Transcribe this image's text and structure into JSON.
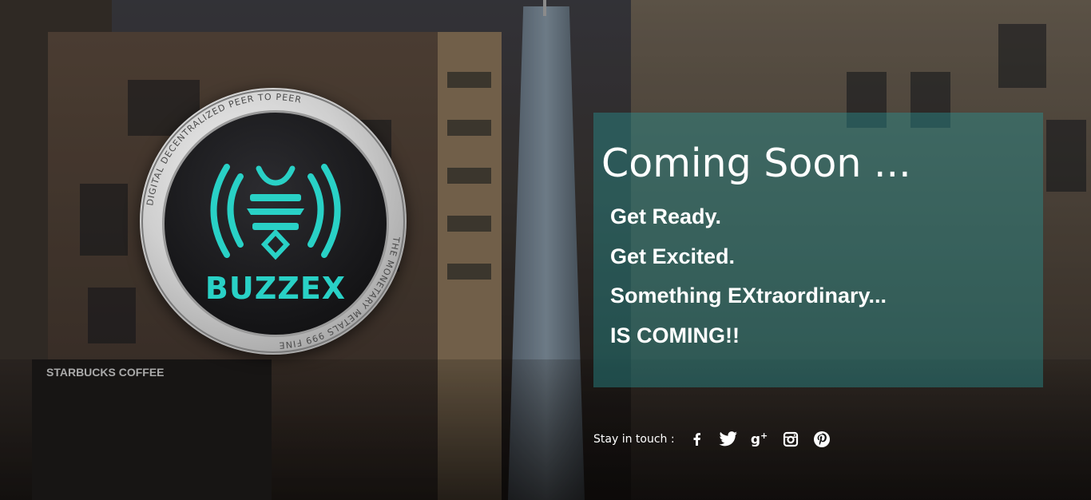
{
  "coin": {
    "brand": "BUZZEX",
    "ring_text": "DIGITAL DECENTRALIZED PEER TO PEER",
    "ring_text_bottom": "THE MONETARY METALS 999 FINE"
  },
  "hero": {
    "title": "Coming Soon ...",
    "lines": [
      "Get Ready.",
      "Get Excited.",
      "Something EXtraordinary...",
      "IS COMING!!"
    ]
  },
  "social": {
    "label": "Stay in touch :",
    "icons": [
      "facebook-icon",
      "twitter-icon",
      "google-plus-icon",
      "instagram-icon",
      "pinterest-icon"
    ]
  },
  "colors": {
    "accent": "#29d1c6",
    "panel": "#2c9696"
  }
}
